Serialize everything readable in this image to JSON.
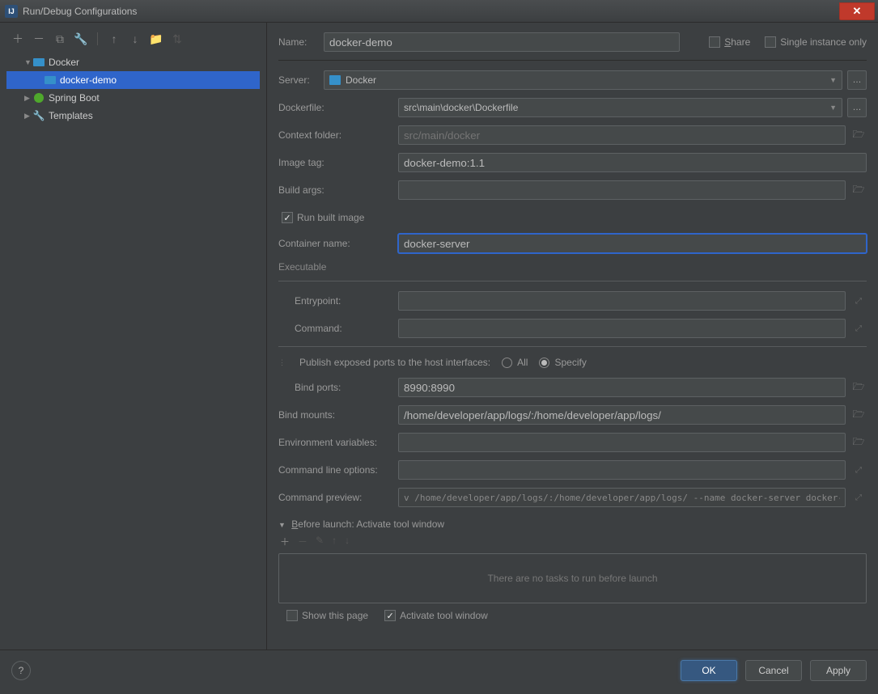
{
  "window": {
    "title": "Run/Debug Configurations"
  },
  "tree": {
    "items": [
      {
        "label": "Docker"
      },
      {
        "label": "docker-demo"
      },
      {
        "label": "Spring Boot"
      },
      {
        "label": "Templates"
      }
    ]
  },
  "form": {
    "name_label": "Name:",
    "name_value": "docker-demo",
    "share_label": "Share",
    "single_instance_label": "Single instance only",
    "server_label": "Server:",
    "server_value": "Docker",
    "dockerfile_label": "Dockerfile:",
    "dockerfile_value": "src\\main\\docker\\Dockerfile",
    "context_label": "Context folder:",
    "context_placeholder": "src/main/docker",
    "image_tag_label": "Image tag:",
    "image_tag_value": "docker-demo:1.1",
    "build_args_label": "Build args:",
    "build_args_value": "",
    "run_built_label": "Run built image",
    "container_name_label": "Container name:",
    "container_name_value": "docker-server",
    "executable_label": "Executable",
    "entrypoint_label": "Entrypoint:",
    "entrypoint_value": "",
    "command_label": "Command:",
    "command_value": "",
    "publish_label": "Publish exposed ports to the host interfaces:",
    "publish_all": "All",
    "publish_specify": "Specify",
    "bind_ports_label": "Bind ports:",
    "bind_ports_value": "8990:8990",
    "bind_mounts_label": "Bind mounts:",
    "bind_mounts_value": "/home/developer/app/logs/:/home/developer/app/logs/",
    "env_vars_label": "Environment variables:",
    "env_vars_value": "",
    "cli_options_label": "Command line options:",
    "cli_options_value": "",
    "preview_label": "Command preview:",
    "preview_value": "v /home/developer/app/logs/:/home/developer/app/logs/ --name docker-server docker-demo:1.1"
  },
  "before_launch": {
    "header": "Before launch: Activate tool window",
    "empty_text": "There are no tasks to run before launch",
    "show_page": "Show this page",
    "activate_window": "Activate tool window"
  },
  "footer": {
    "ok": "OK",
    "cancel": "Cancel",
    "apply": "Apply"
  }
}
